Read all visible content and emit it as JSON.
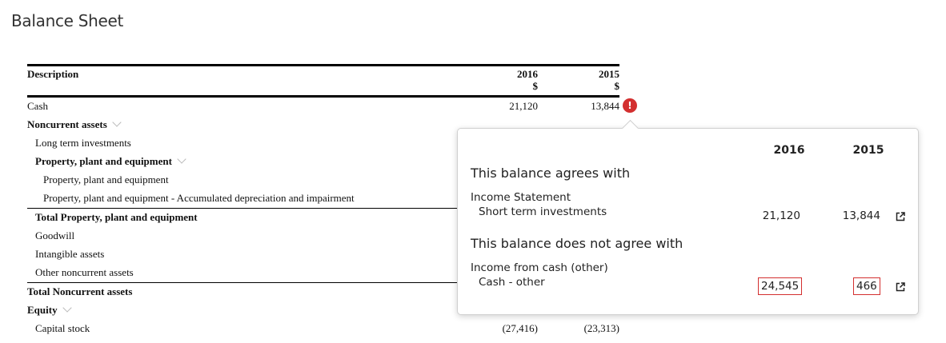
{
  "page": {
    "title": "Balance Sheet"
  },
  "sheet": {
    "header": {
      "description": "Description",
      "col_2016_year": "2016",
      "col_2016_unit": "$",
      "col_2015_year": "2015",
      "col_2015_unit": "$"
    },
    "rows": [
      {
        "label": "Cash",
        "v2016": "21,120",
        "v2015": "13,844"
      },
      {
        "label": "Noncurrent assets"
      },
      {
        "label": "Long term investments"
      },
      {
        "label": "Property, plant and equipment"
      },
      {
        "label": "Property, plant and equipment"
      },
      {
        "label": "Property, plant and equipment - Accumulated depreciation and impairment"
      },
      {
        "label": "Total Property, plant and equipment"
      },
      {
        "label": "Goodwill"
      },
      {
        "label": "Intangible assets"
      },
      {
        "label": "Other noncurrent assets"
      },
      {
        "label": "Total Noncurrent assets"
      },
      {
        "label": "Equity"
      },
      {
        "label": "Capital stock",
        "v2016": "(27,416)",
        "v2015": "(23,313)"
      }
    ],
    "alert_glyph": "!"
  },
  "popover": {
    "col_2016": "2016",
    "col_2015": "2015",
    "agrees_heading": "This balance agrees with",
    "agrees_source": "Income Statement",
    "agrees_item": "Short term investments",
    "agrees_v2016": "21,120",
    "agrees_v2015": "13,844",
    "disagrees_heading": "This balance does not agree with",
    "disagrees_source": "Income from cash (other)",
    "disagrees_item": "Cash - other",
    "disagrees_v2016": "24,545",
    "disagrees_v2015": "466"
  },
  "colors": {
    "alert": "#d32f2f",
    "text": "#222222"
  },
  "icons": [
    "alert-icon",
    "chevron-down-icon",
    "external-link-icon"
  ]
}
